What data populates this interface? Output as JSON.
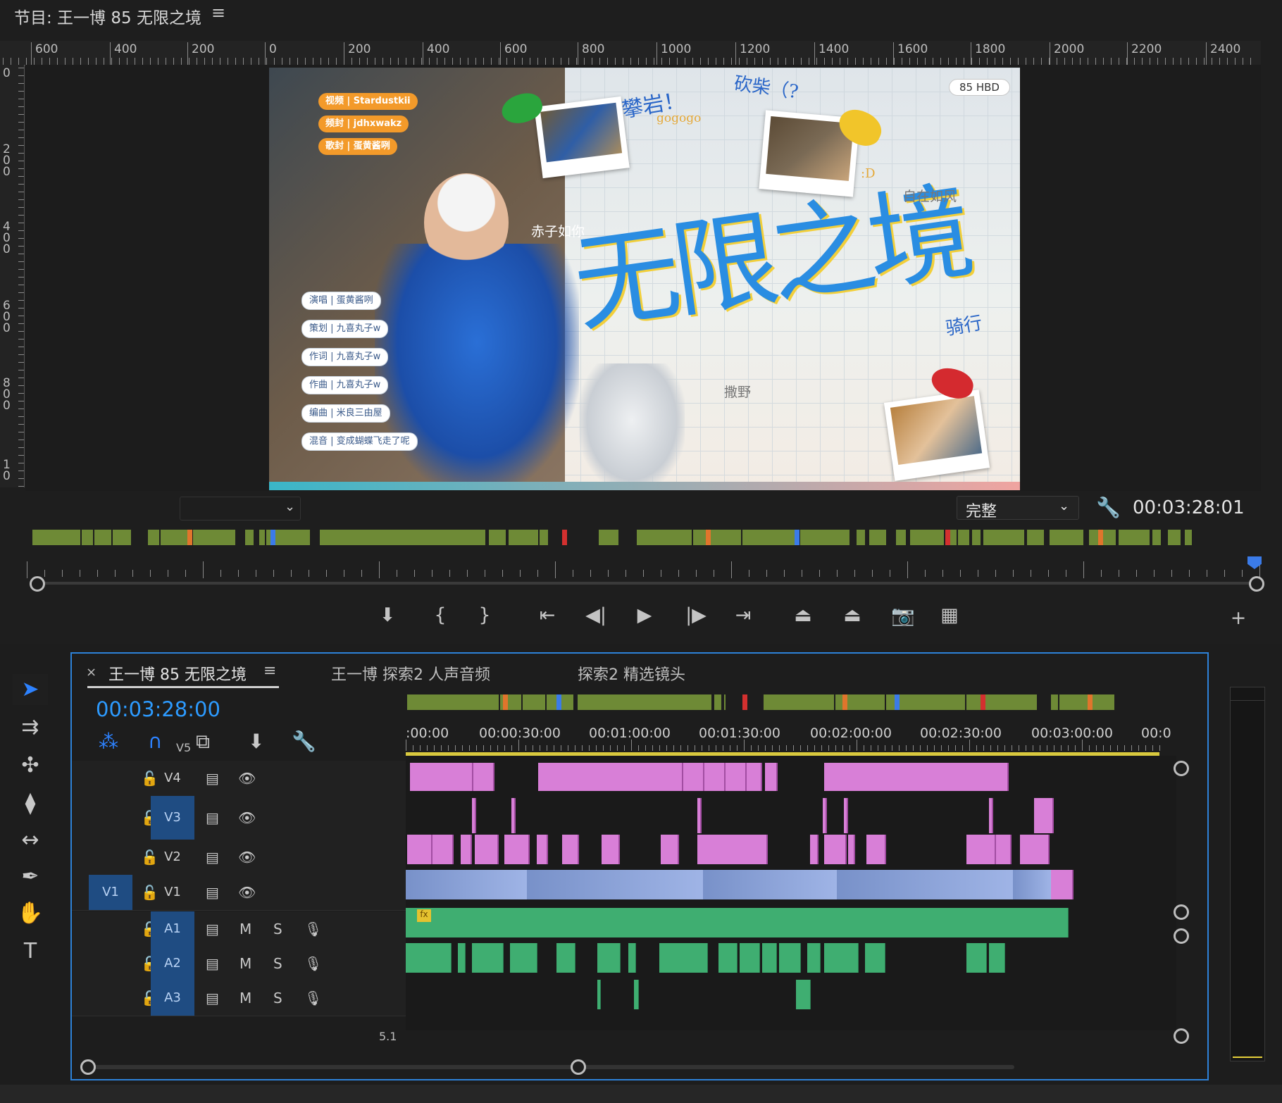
{
  "program": {
    "title": "节目: 王一博 85 无限之境",
    "menu_icon": "≡",
    "h_ruler_labels": [
      "600",
      "400",
      "200",
      "0",
      "200",
      "400",
      "600",
      "800",
      "1000",
      "1200",
      "1400",
      "1600",
      "1800",
      "2000",
      "2200",
      "2400"
    ],
    "v_ruler_labels": [
      "0",
      "200",
      "400",
      "600",
      "800",
      "10"
    ],
    "frame": {
      "credits_top": [
        "视频 | Stardustkii",
        "频封 | jdhxwakz",
        "歌封 | 蛋黄酱咧"
      ],
      "credits_bottom": [
        "演唱 | 蛋黄酱咧",
        "策划 | 九喜丸子w",
        "作词 | 九喜丸子w",
        "作曲 | 九喜丸子w",
        "编曲 | 米良三由屋",
        "混音 | 变成蝴蝶飞走了呢"
      ],
      "hbd": "85 HBD",
      "title_art": "无限之境",
      "notes": [
        "攀岩！",
        "gogogo",
        "砍柴（?",
        "赤子如你",
        ":D",
        "自在如风",
        "骑行",
        "撒野"
      ]
    },
    "zoom_value": "",
    "quality": "完整",
    "quality_chevron": "⌄",
    "wrench_icon": "🔧",
    "timecode": "00:03:28:01",
    "transport_icons": [
      "⬇",
      "{",
      "}",
      "⇤",
      "◀|",
      "▶",
      "|▶",
      "⇥",
      "⏏",
      "⏏",
      "📷",
      "▦",
      "+"
    ]
  },
  "timeline": {
    "tabs": [
      {
        "label": "王一博 85 无限之境",
        "active": true
      },
      {
        "label": "王一博 探索2 人声音频",
        "active": false
      },
      {
        "label": "探索2 精选镜头",
        "active": false
      }
    ],
    "close_icon": "×",
    "tab_menu_icon": "≡",
    "timecode": "00:03:28:00",
    "time_labels": [
      ":00:00",
      "00:00:30:00",
      "00:01:00:00",
      "00:01:30:00",
      "00:02:00:00",
      "00:02:30:00",
      "00:03:00:00",
      "00:0"
    ],
    "v5_label": "V5",
    "tracks": [
      {
        "name": "V4",
        "kind": "video",
        "patch": ""
      },
      {
        "name": "V3",
        "kind": "video",
        "patch": "",
        "highlight": true
      },
      {
        "name": "V2",
        "kind": "video",
        "patch": ""
      },
      {
        "name": "V1",
        "kind": "video",
        "patch": "V1"
      },
      {
        "name": "A1",
        "kind": "audio",
        "patch": ""
      },
      {
        "name": "A2",
        "kind": "audio",
        "patch": ""
      },
      {
        "name": "A3",
        "kind": "audio",
        "patch": ""
      }
    ],
    "audio_m": "M",
    "audio_s": "S",
    "bottom_partial_label": "5.1",
    "fx_badge": "fx"
  },
  "tools": [
    "selection-tool",
    "track-select-tool",
    "ripple-edit-tool",
    "razor-tool",
    "slip-tool",
    "pen-tool",
    "hand-tool",
    "type-tool"
  ],
  "colors": {
    "accent": "#2d82ff",
    "video_clip": "#d87fd7",
    "v1_clip": "#8ea5dc",
    "audio_clip": "#3fae71",
    "mini_clip": "#6e8a36"
  }
}
